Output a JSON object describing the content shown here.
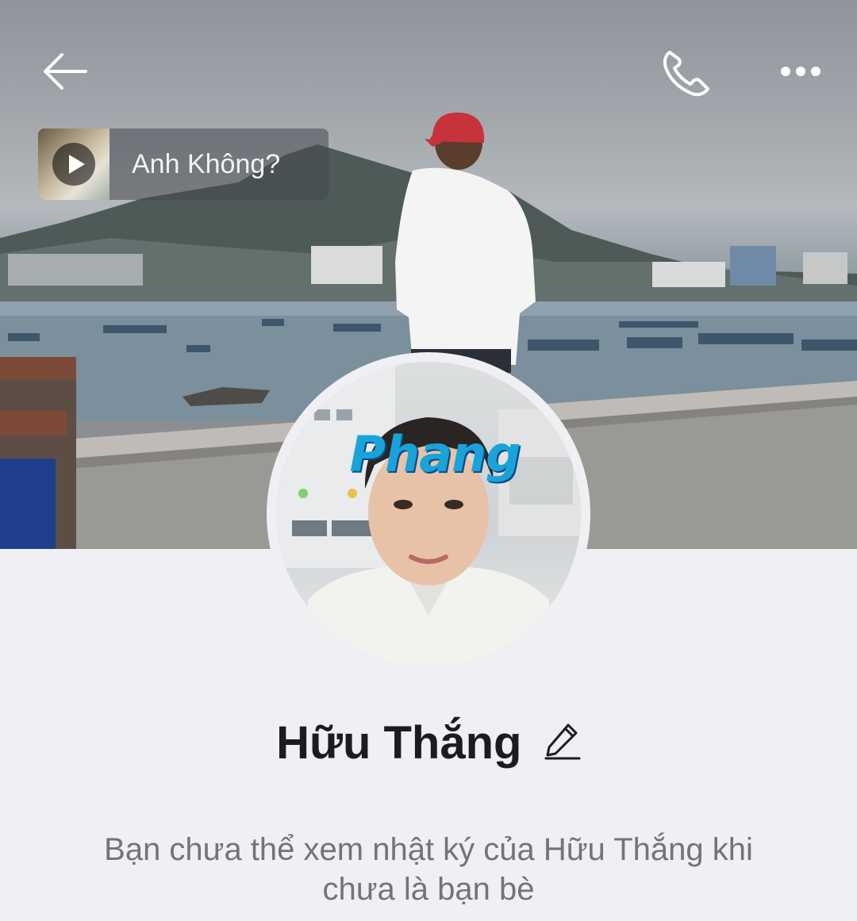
{
  "music": {
    "title": "Anh Không?",
    "thumbnail_icon": "album-art",
    "play_icon": "play-icon"
  },
  "topbar": {
    "back_icon": "back-arrow-icon",
    "call_icon": "phone-icon",
    "more_icon": "more-dots-icon"
  },
  "avatar": {
    "watermark": "Phang"
  },
  "profile": {
    "name": "Hữu Thắng",
    "edit_icon": "pencil-icon",
    "message": "Bạn chưa thể xem nhật ký của Hữu Thắng khi chưa là bạn bè"
  },
  "colors": {
    "page_background": "#f0f0f4",
    "name_text": "#1c1c1e",
    "message_text": "#737378"
  }
}
